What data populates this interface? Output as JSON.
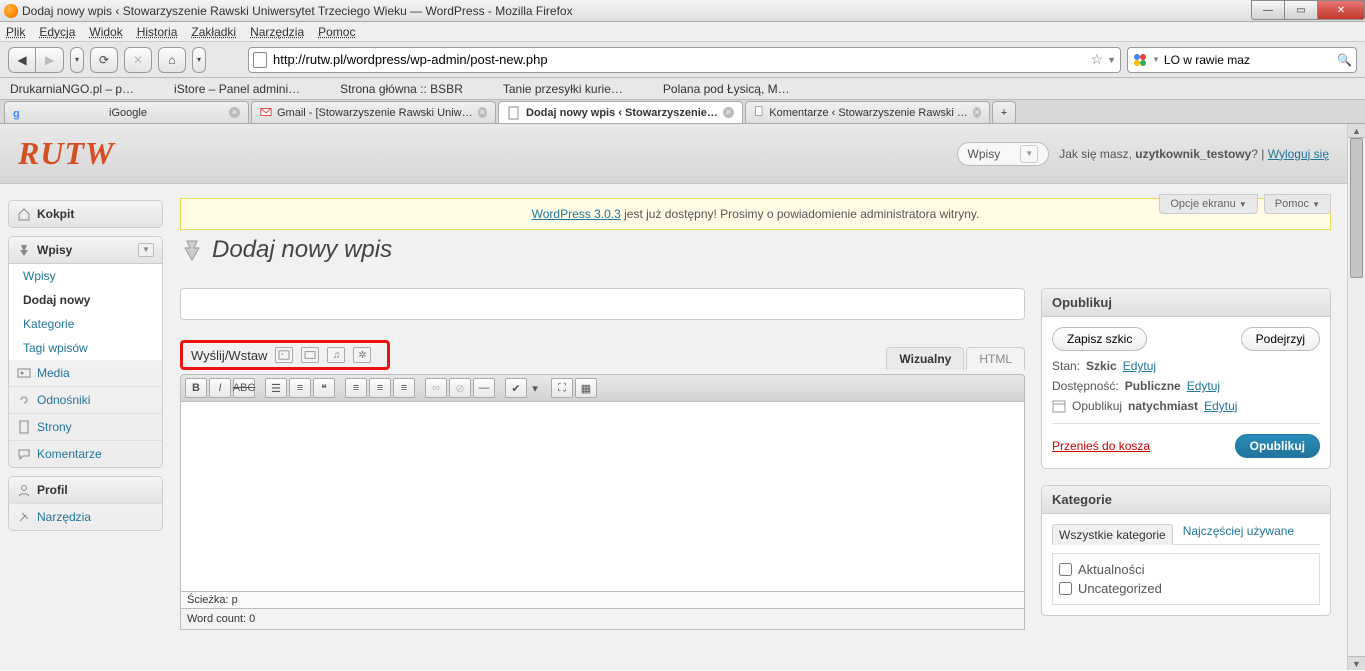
{
  "window": {
    "title": "Dodaj nowy wpis ‹ Stowarzyszenie Rawski Uniwersytet Trzeciego Wieku — WordPress - Mozilla Firefox"
  },
  "menubar": [
    "Plik",
    "Edycja",
    "Widok",
    "Historia",
    "Zakładki",
    "Narzędzia",
    "Pomoc"
  ],
  "url": "http://rutw.pl/wordpress/wp-admin/post-new.php",
  "search_value": "LO w rawie maz",
  "bookmarks": [
    "DrukarniaNGO.pl – p…",
    "iStore – Panel admini…",
    "Strona główna :: BSBR",
    "Tanie przesyłki kurie…",
    "Polana pod Łysicą, M…"
  ],
  "tabs": [
    {
      "label": "iGoogle"
    },
    {
      "label": "Gmail - [Stowarzyszenie Rawski Uniw…"
    },
    {
      "label": "Dodaj nowy wpis ‹ Stowarzyszenie…",
      "active": true
    },
    {
      "label": "Komentarze ‹ Stowarzyszenie Rawski …"
    }
  ],
  "wp": {
    "logo": "RUTW",
    "fav_dropdown": "Wpisy",
    "greeting_prefix": "Jak się masz, ",
    "username": "uzytkownik_testowy",
    "greeting_suffix": "? | ",
    "logout": "Wyloguj się",
    "notice_link": "WordPress 3.0.3",
    "notice_rest": " jest już dostępny! Prosimy o powiadomienie administratora witryny.",
    "screen_options": "Opcje ekranu",
    "help": "Pomoc",
    "heading": "Dodaj nowy wpis",
    "sidebar": {
      "dashboard": "Kokpit",
      "posts": "Wpisy",
      "posts_sub": [
        "Wpisy",
        "Dodaj nowy",
        "Kategorie",
        "Tagi wpisów"
      ],
      "media": "Media",
      "links": "Odnośniki",
      "pages": "Strony",
      "comments": "Komentarze",
      "profile": "Profil",
      "tools": "Narzędzia"
    },
    "upload_label": "Wyślij/Wstaw",
    "editor_tabs": {
      "visual": "Wizualny",
      "html": "HTML"
    },
    "editor_path": "Ścieżka: p",
    "word_count": "Word count: 0",
    "publish": {
      "title": "Opublikuj",
      "save_draft": "Zapisz szkic",
      "preview": "Podejrzyj",
      "status_label": "Stan:",
      "status_value": "Szkic",
      "edit": "Edytuj",
      "visibility_label": "Dostępność:",
      "visibility_value": "Publiczne",
      "schedule_label": "Opublikuj",
      "schedule_value": "natychmiast",
      "trash": "Przenieś do kosza",
      "publish_btn": "Opublikuj"
    },
    "categories": {
      "title": "Kategorie",
      "tab_all": "Wszystkie kategorie",
      "tab_pop": "Najczęściej używane",
      "items": [
        "Aktualności",
        "Uncategorized"
      ]
    }
  }
}
